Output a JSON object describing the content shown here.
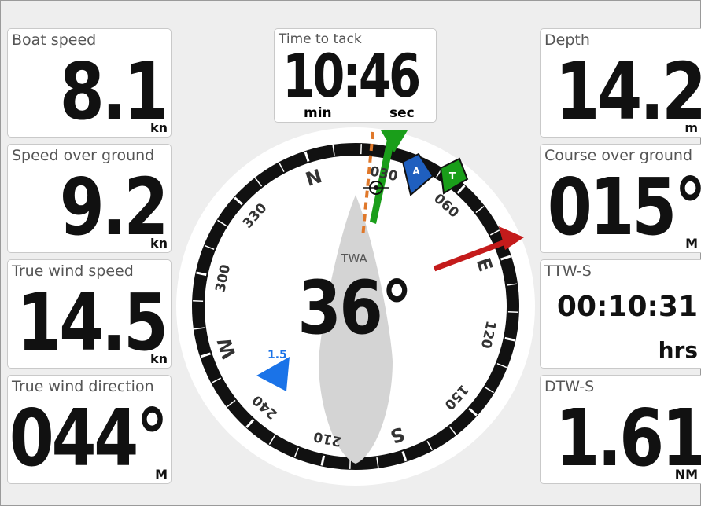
{
  "left": {
    "boat_speed": {
      "label": "Boat speed",
      "value": "8.1",
      "unit": "kn"
    },
    "sog": {
      "label": "Speed over ground",
      "value": "9.2",
      "unit": "kn"
    },
    "tws": {
      "label": "True wind speed",
      "value": "14.5",
      "unit": "kn"
    },
    "twd": {
      "label": "True wind direction",
      "value": "044°",
      "unit": "M"
    }
  },
  "center": {
    "time_to_tack": {
      "label": "Time to tack",
      "value": "10:46",
      "unit_min": "min",
      "unit_sec": "sec"
    },
    "twa_label": "TWA",
    "twa_value": "36°",
    "compass": {
      "cardinals": [
        "N",
        "E",
        "S",
        "W"
      ],
      "degree_labels": [
        "030",
        "060",
        "120",
        "150",
        "210",
        "240",
        "300",
        "330"
      ],
      "marker_apparent": "A",
      "marker_true": "T",
      "current_speed": "1.5",
      "colors": {
        "ring": "#111111",
        "true_wind": "#1a9e1a",
        "apparent": "#1f5fbf",
        "current": "#1a73e8",
        "heading": "#c41b1b",
        "layline": "#e0782a"
      }
    }
  },
  "right": {
    "depth": {
      "label": "Depth",
      "value": "14.2",
      "unit": "m"
    },
    "cog": {
      "label": "Course over ground",
      "value": "015°",
      "unit": "M"
    },
    "ttws": {
      "label": "TTW-S",
      "value": "00:10:31",
      "unit": "hrs"
    },
    "dtws": {
      "label": "DTW-S",
      "value": "1.61",
      "unit": "NM"
    }
  }
}
